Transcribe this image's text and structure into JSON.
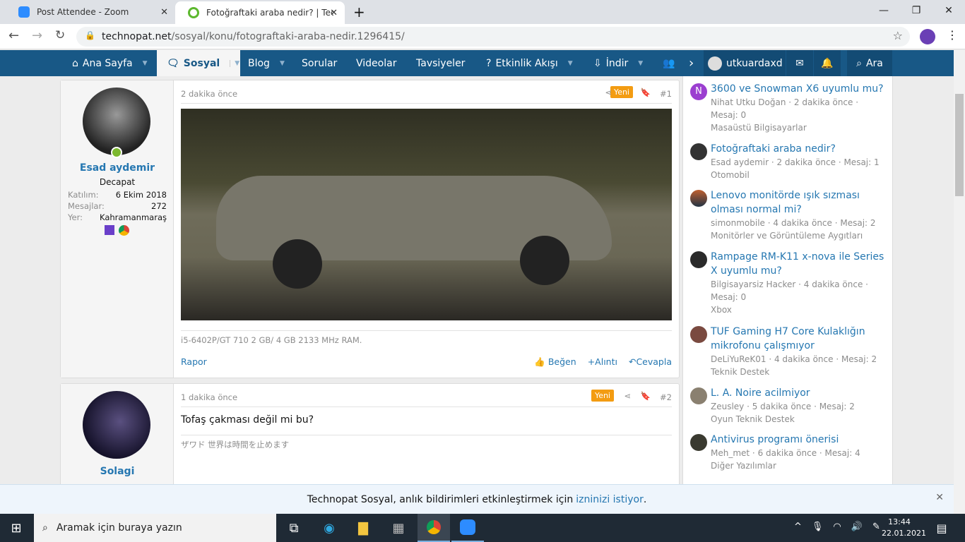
{
  "browser": {
    "tabs": [
      {
        "title": "Post Attendee - Zoom",
        "icon": "zoom-icon"
      },
      {
        "title": "Fotoğraftaki araba nedir? | Techn",
        "icon": "technopat-icon"
      }
    ],
    "url_host": "technopat.net",
    "url_path": "/sosyal/konu/fotograftaki-araba-nedir.1296415/"
  },
  "nav": {
    "items": [
      "Ana Sayfa",
      "Sosyal",
      "Blog",
      "Sorular",
      "Videolar",
      "Tavsiyeler",
      "Etkinlik Akışı",
      "İndir"
    ],
    "user": "utkuardaxd",
    "search": "Ara",
    "color": "#185886"
  },
  "posts": [
    {
      "time": "2 dakika önce",
      "badge": "Yeni",
      "num": "#1",
      "user": "Esad aydemir",
      "title": "Decapat",
      "join_label": "Katılım:",
      "join": "6 Ekim 2018",
      "msgs_label": "Mesajlar:",
      "msgs": "272",
      "loc_label": "Yer:",
      "loc": "Kahramanmaraş",
      "signature": "i5-6402P/GT 710 2 GB/ 4 GB 2133 MHz RAM.",
      "report": "Rapor",
      "like": "Beğen",
      "quote": "Alıntı",
      "reply": "Cevapla"
    },
    {
      "time": "1 dakika önce",
      "badge": "Yeni",
      "num": "#2",
      "user": "Solagi",
      "text": "Tofaş çakması değil mi bu?",
      "signature": "ザワド 世界は時間を止めます"
    }
  ],
  "sidebar": [
    {
      "title": "3600 ve Snowman X6 uyumlu mu?",
      "meta": "Nihat Utku Doğan · 2 dakika önce · Mesaj: 0",
      "forum": "Masaüstü Bilgisayarlar"
    },
    {
      "title": "Fotoğraftaki araba nedir?",
      "meta": "Esad aydemir · 2 dakika önce · Mesaj: 1",
      "forum": "Otomobil"
    },
    {
      "title": "Lenovo monitörde ışık sızması olması normal mi?",
      "meta": "simonmobile · 4 dakika önce · Mesaj: 2",
      "forum": "Monitörler ve Görüntüleme Aygıtları"
    },
    {
      "title": "Rampage RM-K11 x-nova ile Series X uyumlu mu?",
      "meta": "Bilgisayarsiz Hacker · 4 dakika önce · Mesaj: 0",
      "forum": "Xbox"
    },
    {
      "title": "TUF Gaming H7 Core Kulaklığın mikrofonu çalışmıyor",
      "meta": "DeLiYuReK01 · 4 dakika önce · Mesaj: 2",
      "forum": "Teknik Destek"
    },
    {
      "title": "L. A. Noire acilmiyor",
      "meta": "Zeusley · 5 dakika önce · Mesaj: 2",
      "forum": "Oyun Teknik Destek"
    },
    {
      "title": "Antivirus programı önerisi",
      "meta": "Meh_met · 6 dakika önce · Mesaj: 4",
      "forum": "Diğer Yazılımlar"
    }
  ],
  "notification": {
    "text": "Technopat Sosyal, anlık bildirimleri etkinleştirmek için ",
    "link": "izninizi istiyor",
    "end": "."
  },
  "taskbar": {
    "search": "Aramak için buraya yazın",
    "time": "13:44",
    "date": "22.01.2021"
  }
}
